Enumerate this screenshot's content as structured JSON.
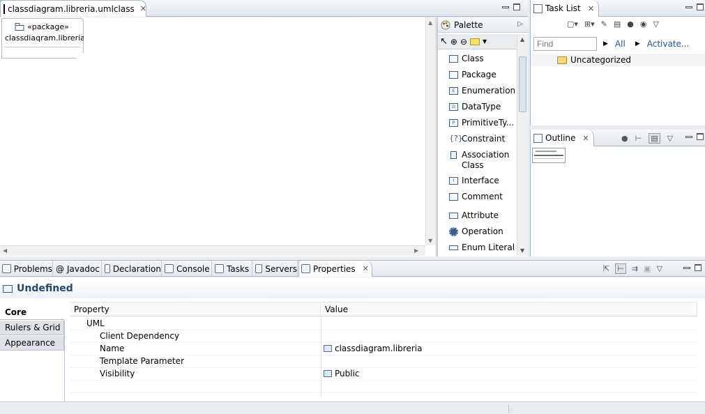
{
  "editor": {
    "tab_title": "classdiagram.libreria.umlclass",
    "package_stereotype": "«package»",
    "package_name": "classdiaqram.libreria"
  },
  "palette": {
    "title": "Palette",
    "items": [
      {
        "label": "Class",
        "icon": "class-icon"
      },
      {
        "label": "Package",
        "icon": "package-icon"
      },
      {
        "label": "Enumeration",
        "icon": "enumeration-icon"
      },
      {
        "label": "DataType",
        "icon": "datatype-icon"
      },
      {
        "label": "PrimitiveTy...",
        "icon": "primitive-type-icon"
      },
      {
        "label": "Constraint",
        "icon": "constraint-icon"
      },
      {
        "label": "Association",
        "label2": "Class",
        "icon": "association-class-icon"
      },
      {
        "label": "Interface",
        "icon": "interface-icon"
      },
      {
        "label": "Comment",
        "icon": "comment-icon"
      },
      {
        "label": "Attribute",
        "icon": "attribute-icon"
      },
      {
        "label": "Operation",
        "icon": "operation-icon"
      },
      {
        "label": "Enum Literal",
        "icon": "enum-literal-icon"
      }
    ]
  },
  "tasklist": {
    "title": "Task List",
    "find_placeholder": "Find",
    "filter_all": "All",
    "activate": "Activate...",
    "category": "Uncategorized"
  },
  "outline": {
    "title": "Outline"
  },
  "bottom": {
    "tabs": [
      "Problems",
      "Javadoc",
      "Declaration",
      "Console",
      "Tasks",
      "Servers",
      "Properties"
    ],
    "active_tab": "Properties"
  },
  "properties": {
    "title": "Undefined",
    "side_tabs": [
      "Core",
      "Rulers & Grid",
      "Appearance"
    ],
    "col_property": "Property",
    "col_value": "Value",
    "rows": [
      {
        "property": "UML",
        "value": ""
      },
      {
        "property": "Client Dependency",
        "value": ""
      },
      {
        "property": "Name",
        "value": "classdiagram.libreria"
      },
      {
        "property": "Template Parameter",
        "value": ""
      },
      {
        "property": "Visibility",
        "value": "Public"
      }
    ]
  },
  "colors": {
    "accent": "#254778",
    "link": "#2152a3",
    "border": "#a9b6c5"
  }
}
